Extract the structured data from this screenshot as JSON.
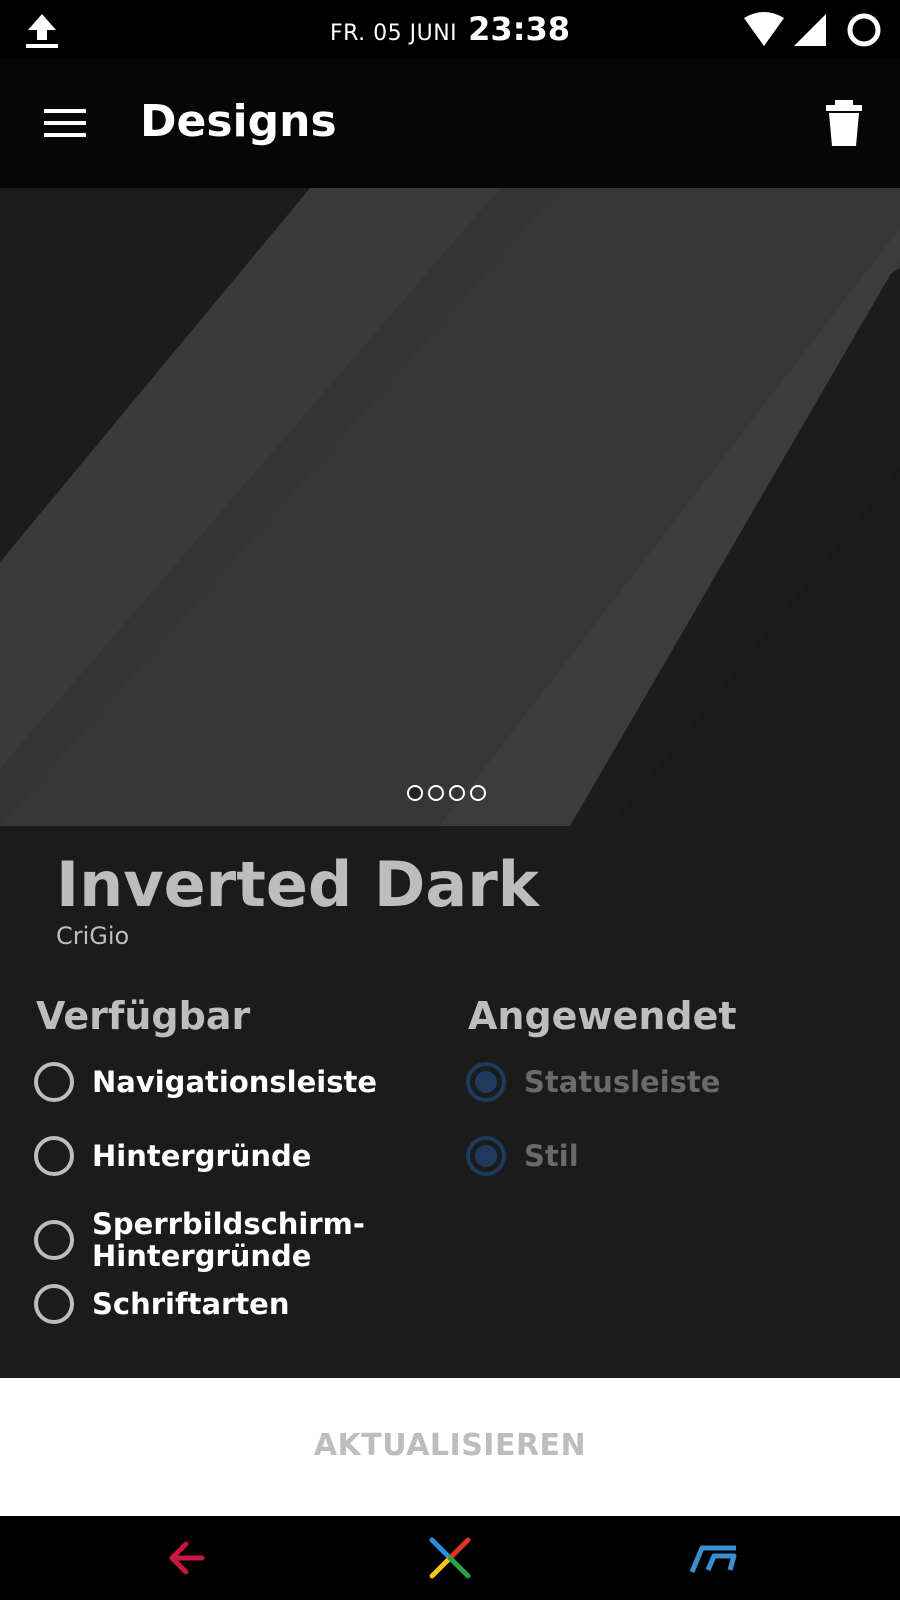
{
  "status_bar": {
    "date": "FR. 05 JUNI",
    "time": "23:38",
    "icons": [
      "upload-icon",
      "wifi-icon",
      "signal-icon",
      "sync-ring-icon"
    ]
  },
  "app_bar": {
    "title": "Designs",
    "icons": [
      "menu-icon",
      "trash-icon"
    ]
  },
  "hero": {
    "page_count": 4,
    "active_page": 1
  },
  "theme": {
    "name": "Inverted Dark",
    "author": "CriGio"
  },
  "available": {
    "heading": "Verfügbar",
    "items": [
      {
        "label": "Navigationsleiste",
        "checked": false
      },
      {
        "label": "Hintergründe",
        "checked": false
      },
      {
        "label_line1": "Sperrbildschirm-",
        "label_line2": "Hintergründe",
        "checked": false
      },
      {
        "label": "Schriftarten",
        "checked": false
      }
    ]
  },
  "applied": {
    "heading": "Angewendet",
    "items": [
      {
        "label": "Statusleiste",
        "checked": true
      },
      {
        "label": "Stil",
        "checked": true
      }
    ]
  },
  "update_button": {
    "label": "AKTUALISIEREN"
  },
  "nav_bar": {
    "icons": [
      "back-icon",
      "home-icon",
      "recents-icon"
    ]
  },
  "colors": {
    "background": "#000000",
    "panel": "#1b1b1b",
    "checked_radio": "#1e3a5f",
    "back_icon": "#c8163f",
    "recents_icon": "#3a8fd0"
  }
}
